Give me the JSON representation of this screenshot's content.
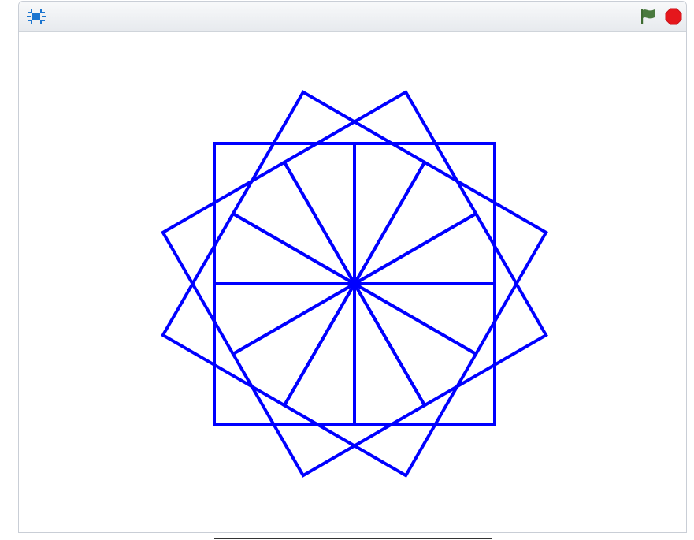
{
  "toolbar": {
    "fullscreen_icon": "fullscreen-toggle-icon",
    "green_flag_icon": "green-flag-icon",
    "stop_icon": "stop-sign-icon"
  },
  "colors": {
    "pen": "#0000ff",
    "flag": "#4a7a3e",
    "stop": "#e5171c",
    "fullscreen_icon": "#1b75d0"
  },
  "drawing": {
    "shape": "square",
    "count": 12,
    "rotation_step_deg": 30,
    "pen_size": 4
  }
}
